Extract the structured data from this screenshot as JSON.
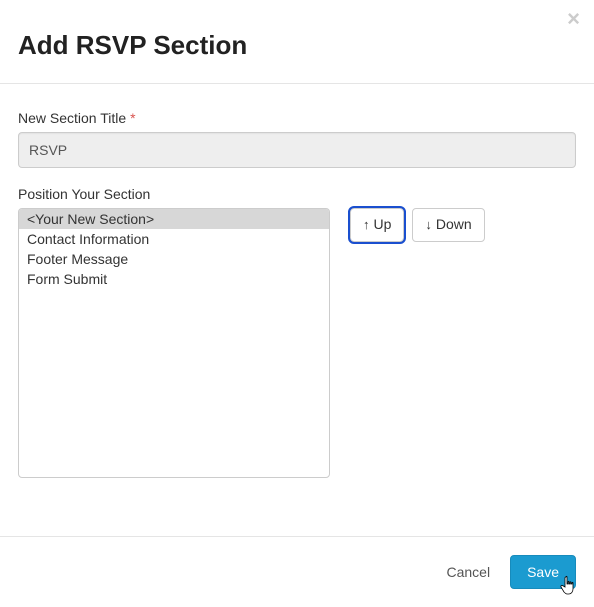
{
  "header": {
    "title": "Add RSVP Section"
  },
  "form": {
    "title_label": "New Section Title",
    "title_required": "*",
    "title_value": "RSVP",
    "position_label": "Position Your Section",
    "sections": [
      {
        "label": "<Your New Section>",
        "selected": true
      },
      {
        "label": "Contact Information",
        "selected": false
      },
      {
        "label": "Footer Message",
        "selected": false
      },
      {
        "label": "Form Submit",
        "selected": false
      }
    ],
    "up_label": "Up",
    "down_label": "Down"
  },
  "footer": {
    "cancel_label": "Cancel",
    "save_label": "Save"
  }
}
